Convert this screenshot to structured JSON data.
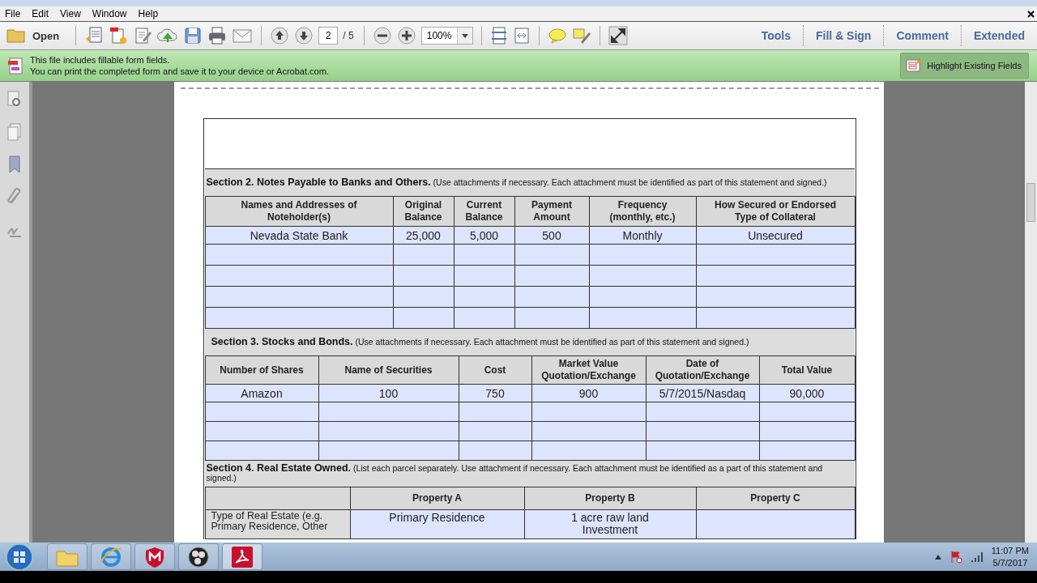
{
  "menu": [
    "File",
    "Edit",
    "View",
    "Window",
    "Help"
  ],
  "toolbar": {
    "open_label": "Open",
    "page": "2",
    "page_total": "/ 5",
    "zoom": "100%"
  },
  "panes": [
    "Tools",
    "Fill & Sign",
    "Comment",
    "Extended"
  ],
  "banner": {
    "lines": [
      "This file includes fillable form fields.",
      "You can print the completed form and save it to your device or Acrobat.com."
    ],
    "button": "Highlight Existing Fields"
  },
  "section2": {
    "heading": "**Section 2.  Notes Payable to Banks and Others.** (Use attachments if necessary. Each attachment must be identified as part of this statement and signed.)",
    "columns": [
      [
        "Names and Addresses of",
        "Noteholder(s)"
      ],
      [
        "Original",
        "Balance"
      ],
      [
        "Current",
        "Balance"
      ],
      [
        "Payment",
        "Amount"
      ],
      [
        "Frequency",
        "(monthly, etc.)"
      ],
      [
        "How Secured or Endorsed",
        "Type of Collateral"
      ]
    ],
    "rows": [
      {
        "kind": "filled",
        "cells": [
          "Nevada State Bank",
          "25,000",
          "5,000",
          "500",
          "Monthly",
          "Unsecured"
        ]
      },
      {
        "kind": "blank"
      },
      {
        "kind": "blank"
      },
      {
        "kind": "blank"
      },
      {
        "kind": "blank"
      }
    ]
  },
  "section3": {
    "heading": "**Section 3.  Stocks and Bonds.** (Use attachments if necessary.  Each attachment must be identified as part of this statement and signed.)",
    "columns": [
      [
        "Number of Shares"
      ],
      [
        "Name of Securities"
      ],
      [
        "Cost"
      ],
      [
        "Market Value",
        "Quotation/Exchange"
      ],
      [
        "Date of",
        "Quotation/Exchange"
      ],
      [
        "Total Value"
      ]
    ],
    "rows": [
      {
        "kind": "filled",
        "cells": [
          "Amazon",
          "100",
          "750",
          "900",
          "5/7/2015/Nasdaq",
          "90,000"
        ]
      },
      {
        "kind": "blank"
      },
      {
        "kind": "blank"
      },
      {
        "kind": "blank"
      }
    ]
  },
  "section4": {
    "heading": "**Section 4.  Real Estate Owned.** (List each parcel separately.  Use attachment if necessary.  Each attachment must be identified as a part of this statement and signed.)",
    "columns": [
      "Property A",
      "Property B",
      "Property C"
    ],
    "rows": [
      {
        "label": "Type of Real Estate (e.g. Primary Residence, Other",
        "values": [
          [
            "Primary Residence"
          ],
          [
            "1 acre raw land",
            "Investment"
          ]
        ]
      }
    ]
  },
  "taskbar": {
    "time": "11:07 PM",
    "date": "5/7/2017"
  }
}
